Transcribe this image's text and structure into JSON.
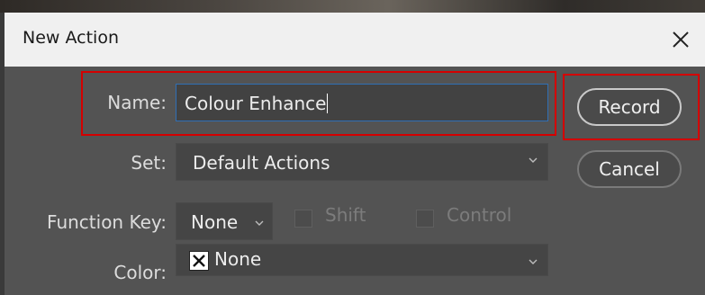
{
  "dialog": {
    "title": "New Action",
    "close_glyph": "close-x-icon"
  },
  "fields": {
    "name_label": "Name:",
    "name_value": "Colour Enhance",
    "set_label": "Set:",
    "set_value": "Default Actions",
    "function_key_label": "Function Key:",
    "function_key_value": "None",
    "shift_label": "Shift",
    "control_label": "Control",
    "color_label": "Color:",
    "color_value": "None"
  },
  "buttons": {
    "record_label": "Record",
    "cancel_label": "Cancel"
  },
  "colors": {
    "dialog_bg": "#535353",
    "title_bg": "#f0f0f0",
    "highlight": "#d40000",
    "focus": "#2f6fb5"
  }
}
